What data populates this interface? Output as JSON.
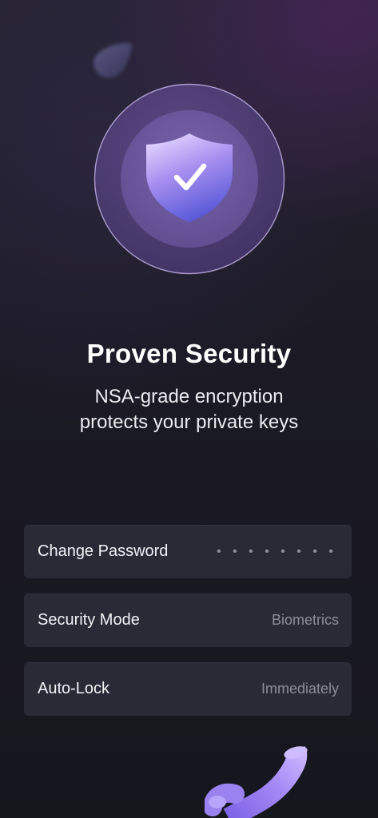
{
  "hero": {
    "title": "Proven Security",
    "subtitle_line1": "NSA-grade encryption",
    "subtitle_line2": "protects your private keys"
  },
  "settings": {
    "items": [
      {
        "label": "Change Password",
        "value": "• • • • • • • •"
      },
      {
        "label": "Security Mode",
        "value": "Biometrics"
      },
      {
        "label": "Auto-Lock",
        "value": "Immediately"
      }
    ]
  },
  "icons": {
    "hero": "shield-check-icon",
    "decor_top": "floating-blob-shape",
    "decor_bottom": "curved-tube-shape"
  },
  "colors": {
    "background": "#16161d",
    "row_background": "#2a2a37",
    "accent": "#8b6fe0",
    "shield_light": "#d6c6ff",
    "shield_dark": "#5a58d8"
  }
}
